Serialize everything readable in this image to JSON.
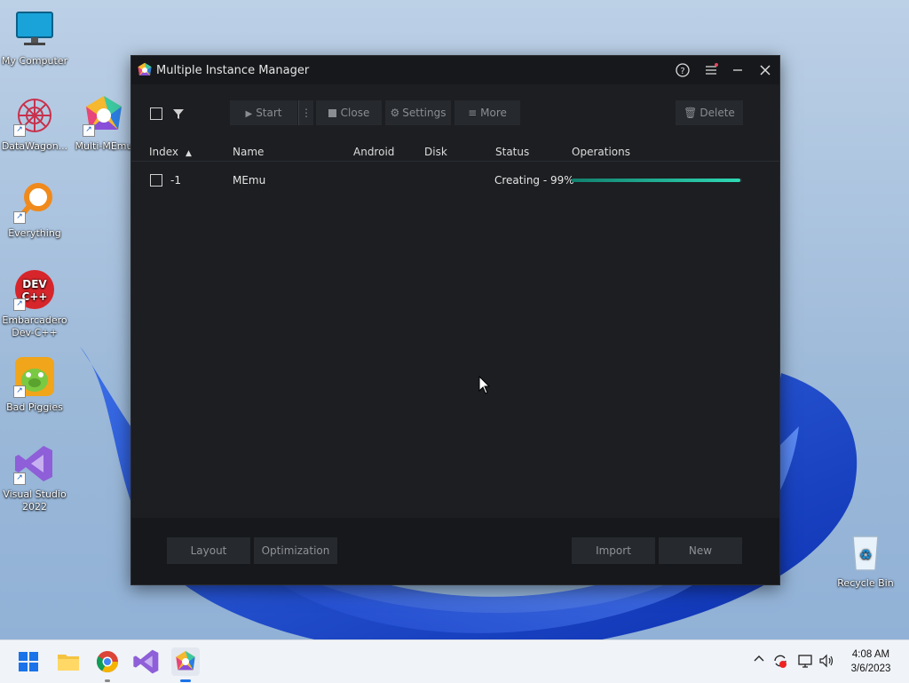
{
  "desktop": {
    "icons": [
      {
        "label": "My Computer"
      },
      {
        "label": "DataWagon..."
      },
      {
        "label": "Multi-MEmu"
      },
      {
        "label": "Everything"
      },
      {
        "label": "Embarcadero Dev-C++"
      },
      {
        "label": "Bad Piggies"
      },
      {
        "label": "Visual Studio 2022"
      },
      {
        "label": "Recycle Bin"
      }
    ]
  },
  "window": {
    "title": "Multiple Instance Manager",
    "toolbar": {
      "start_label": "Start",
      "close_label": "Close",
      "settings_label": "Settings",
      "more_label": "More",
      "delete_label": "Delete"
    },
    "table": {
      "columns": [
        "Index",
        "Name",
        "Android",
        "Disk",
        "Status",
        "Operations"
      ],
      "rows": [
        {
          "index": "-1",
          "name": "MEmu",
          "android": "",
          "disk": "",
          "status": "Creating - 99%",
          "progress": 0.99
        }
      ]
    },
    "footer": {
      "layout_label": "Layout",
      "optimization_label": "Optimization",
      "import_label": "Import",
      "new_label": "New"
    }
  },
  "taskbar": {
    "time": "4:08 AM",
    "date": "3/6/2023"
  },
  "colors": {
    "window_bg": "#1c1e21",
    "progress_accent": "#2fd9b5"
  }
}
